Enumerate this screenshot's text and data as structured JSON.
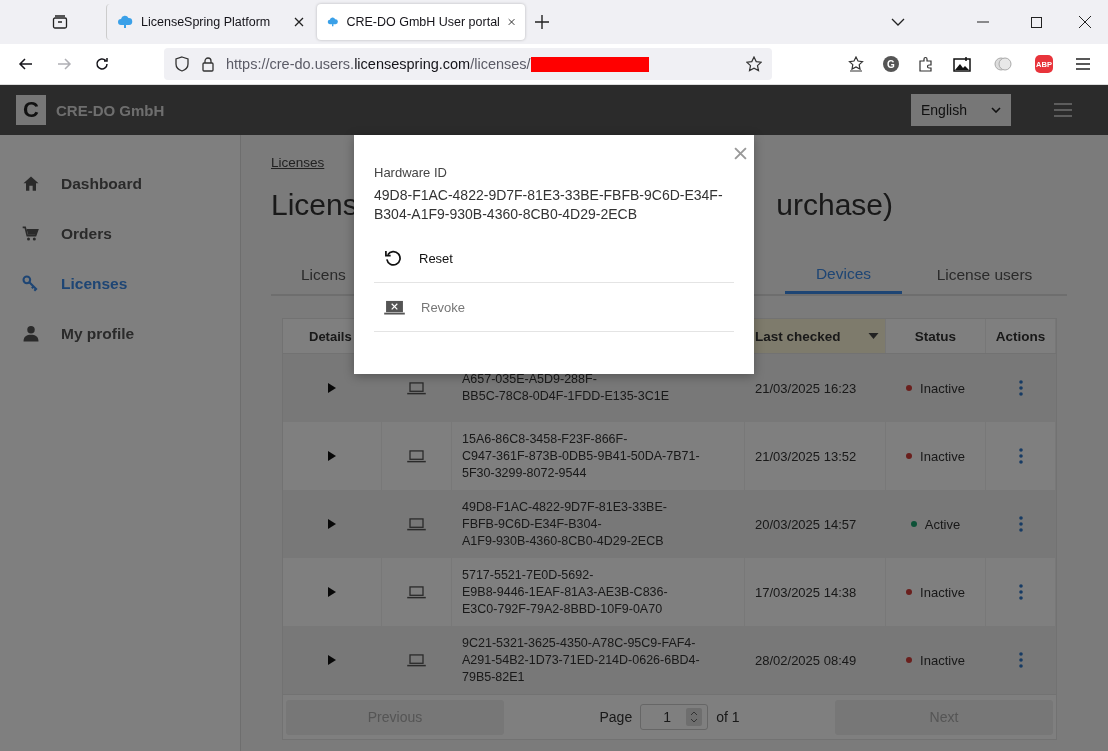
{
  "browser": {
    "tabs": [
      {
        "title": "LicenseSpring Platform",
        "selected": false
      },
      {
        "title": "CRE-DO GmbH User portal",
        "selected": true
      }
    ],
    "nav": [
      {
        "kind": "back",
        "disabled": false
      },
      {
        "kind": "forward",
        "disabled": true
      },
      {
        "kind": "reload",
        "disabled": false
      }
    ],
    "address": {
      "prefix": "https://cre-do.users.",
      "domain": "licensespring.com",
      "path": "/licenses/"
    },
    "extensions": [
      {
        "kind": "letter",
        "label": "G"
      },
      {
        "kind": "abp",
        "label": "ABP"
      }
    ]
  },
  "app": {
    "logo_letter": "C",
    "company": "CRE-DO GmbH",
    "language": "English"
  },
  "sidebar": {
    "items": [
      {
        "label": "Dashboard",
        "selected": false
      },
      {
        "label": "Orders",
        "selected": false
      },
      {
        "label": "Licenses",
        "selected": true
      },
      {
        "label": "My profile",
        "selected": false
      }
    ]
  },
  "breadcrumb": "Licenses",
  "title_parts": [
    "Licens",
    "urchase)"
  ],
  "tabs": [
    {
      "label": "Licens",
      "selected": false
    },
    {
      "label": "Devices",
      "selected": true
    },
    {
      "label": "License users",
      "selected": false
    }
  ],
  "table": {
    "columns": [
      {
        "label": "Details",
        "sorted": false
      },
      {
        "label": "Last checked",
        "sorted": true
      },
      {
        "label": "Status",
        "sorted": false
      },
      {
        "label": "Actions",
        "sorted": false
      }
    ],
    "rows": [
      {
        "hardware_id": "A657-035E-A5D9-288F-\nBB5C-78C8-0D4F-1FDD-E135-3C1E",
        "last_checked": "21/03/2025 16:23",
        "status": "Inactive",
        "active": false
      },
      {
        "hardware_id": "15A6-86C8-3458-F23F-866F-\nC947-361F-873B-0DB5-9B41-50DA-7B71-\n5F30-3299-8072-9544",
        "last_checked": "21/03/2025 13:52",
        "status": "Inactive",
        "active": false
      },
      {
        "hardware_id": "49D8-F1AC-4822-9D7F-81E3-33BE-\nFBFB-9C6D-E34F-B304-\nA1F9-930B-4360-8CB0-4D29-2ECB",
        "last_checked": "20/03/2025 14:57",
        "status": "Active",
        "active": true
      },
      {
        "hardware_id": "5717-5521-7E0D-5692-\nE9B8-9446-1EAF-81A3-AE3B-C836-\nE3C0-792F-79A2-8BBD-10F9-0A70",
        "last_checked": "17/03/2025 14:38",
        "status": "Inactive",
        "active": false
      },
      {
        "hardware_id": "9C21-5321-3625-4350-A78C-95C9-FAF4-\nA291-54B2-1D73-71ED-214D-0626-6BD4-\n79B5-82E1",
        "last_checked": "28/02/2025 08:49",
        "status": "Inactive",
        "active": false
      }
    ]
  },
  "pagination": {
    "previous": "Previous",
    "previous_disabled": true,
    "page_label": "Page",
    "page": "1",
    "of": "of 1",
    "next": "Next",
    "next_disabled": true
  },
  "modal": {
    "label": "Hardware ID",
    "hardware_id": "49D8-F1AC-4822-9D7F-81E3-33BE-FBFB-9C6D-E34F-\nB304-A1F9-930B-4360-8CB0-4D29-2ECB",
    "actions": [
      {
        "label": "Reset",
        "disabled": false
      },
      {
        "label": "Revoke",
        "disabled": true
      }
    ]
  }
}
